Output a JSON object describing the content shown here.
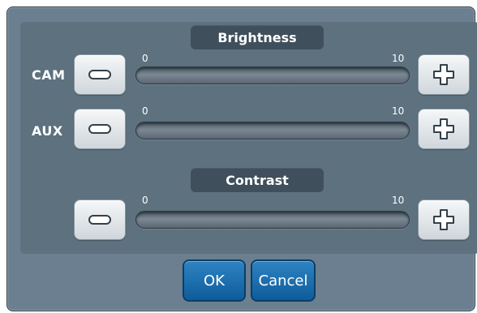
{
  "dialog": {
    "brightness_title": "Brightness",
    "contrast_title": "Contrast",
    "rows": {
      "cam": {
        "label": "CAM",
        "min": "0",
        "max": "10"
      },
      "aux": {
        "label": "AUX",
        "min": "0",
        "max": "10"
      },
      "contrast": {
        "min": "0",
        "max": "10"
      }
    },
    "buttons": {
      "ok": "OK",
      "cancel": "Cancel"
    }
  },
  "icons": {
    "minus": "minus-icon",
    "plus": "plus-icon"
  },
  "colors": {
    "dialog_bg": "#6b7f90",
    "panel_bg": "#5d717f",
    "accent_button": "#1a6fae"
  }
}
